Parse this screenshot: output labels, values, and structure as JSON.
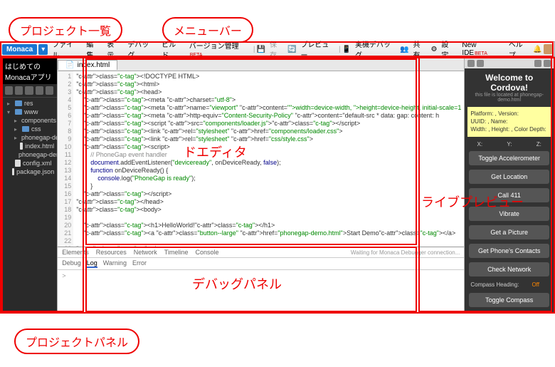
{
  "callouts": {
    "project_list": "プロジェクト一覧",
    "menubar": "メニューバー",
    "editor": "ドエディタ",
    "live_preview": "ライブプレビュー",
    "debug_panel": "デバッグパネル",
    "project_panel": "プロジェクトパネル"
  },
  "brand": "Monaca",
  "menu": {
    "file": "ファイル",
    "edit": "編集",
    "view": "表示",
    "debug": "デバッグ",
    "build": "ビルド",
    "version": "バージョン管理",
    "save": "保存",
    "preview": "プレビュー",
    "device_debug": "実機デバッグ",
    "share": "共有",
    "settings": "設定",
    "new_ide": "New IDE",
    "help": "ヘルプ"
  },
  "sidebar": {
    "title": "はじめてのMonacaアプリ",
    "tree": {
      "root": "www",
      "res": "res",
      "components": "components",
      "css": "css",
      "phonegap_demo": "phonegap-demo",
      "index": "index.html",
      "phonegap_demo_html": "phonegap-demo.html",
      "config": "config.xml",
      "package": "package.json"
    }
  },
  "editor": {
    "tab": "index.html",
    "lines": [
      "<!DOCTYPE HTML>",
      "<html>",
      "<head>",
      "    <meta charset=\"utf-8\">",
      "    <meta name=\"viewport\" content=\"width=device-width, height=device-height, initial-scale=1",
      "    <meta http-equiv=\"Content-Security-Policy\" content=\"default-src * data: gap: content: h",
      "    <script src=\"components/loader.js\"></script>",
      "    <link rel=\"stylesheet\" href=\"components/loader.css\">",
      "    <link rel=\"stylesheet\" href=\"css/style.css\">",
      "    <script>",
      "        // PhoneGap event handler",
      "        document.addEventListener(\"deviceready\", onDeviceReady, false);",
      "        function onDeviceReady() {",
      "            console.log(\"PhoneGap is ready\");",
      "        }",
      "    </script>",
      "</head>",
      "<body>",
      "",
      "    <h1>HelloWorld!</h1>",
      "    <a class=\"button--large\" href=\"phonegap-demo.html\">Start Demo</a>",
      "",
      "</body>"
    ]
  },
  "debug": {
    "tabs1": {
      "elements": "Elements",
      "resources": "Resources",
      "network": "Network",
      "timeline": "Timeline",
      "console": "Console"
    },
    "tabs2": {
      "debug": "Debug",
      "log": "Log",
      "warning": "Warning",
      "error": "Error"
    },
    "status": "Waiting for Monaca Debugger connection...",
    "prompt": ">"
  },
  "preview": {
    "title": "Welcome to Cordova!",
    "subtitle": "this file is located at phonegap-demo.html",
    "info": {
      "platform": "Platform: , Version:",
      "uuid": "UUID: , Name:",
      "dims": "Width: , Height: , Color Depth:"
    },
    "xyz": {
      "x": "X:",
      "y": "Y:",
      "z": "Z:"
    },
    "buttons": {
      "accel": "Toggle Accelerometer",
      "location": "Get Location",
      "call": "Call 411",
      "vibrate": "Vibrate",
      "picture": "Get a Picture",
      "contacts": "Get Phone's Contacts",
      "network": "Check Network",
      "compass_btn": "Toggle Compass"
    },
    "compass_label": "Compass Heading:",
    "compass_value": "Off"
  }
}
